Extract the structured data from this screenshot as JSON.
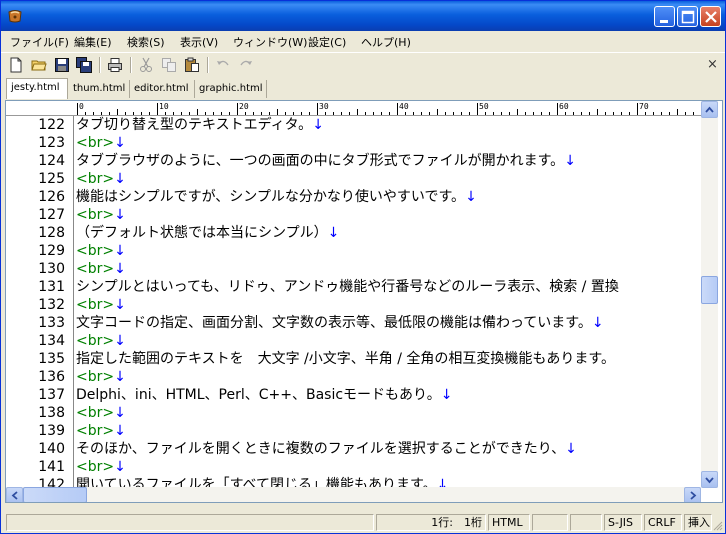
{
  "window": {
    "title": ""
  },
  "menu": [
    "ファイル(F)",
    "編集(E)",
    "検索(S)",
    "表示(V)",
    "ウィンドウ(W)",
    "設定(C)",
    "ヘルプ(H)"
  ],
  "toolbar": {
    "icons": [
      "new-file-icon",
      "open-folder-icon",
      "save-icon",
      "save-all-icon",
      "print-icon",
      "cut-icon",
      "copy-icon",
      "paste-icon",
      "undo-icon",
      "redo-icon"
    ],
    "close_label": "×"
  },
  "tabs": [
    {
      "label": "jesty.html",
      "active": true
    },
    {
      "label": "thum.html",
      "active": false
    },
    {
      "label": "editor.html",
      "active": false
    },
    {
      "label": "graphic.html",
      "active": false
    }
  ],
  "ruler": [
    "0",
    "10",
    "20",
    "30",
    "40",
    "50",
    "60",
    "70"
  ],
  "editor": {
    "eol_mark": "↓",
    "lines": [
      {
        "num": "122",
        "text": "タブ切り替え型のテキストエディタ。",
        "br": false
      },
      {
        "num": "123",
        "text": "<br>",
        "br": true
      },
      {
        "num": "124",
        "text": "タブブラウザのように、一つの画面の中にタブ形式でファイルが開かれます。",
        "br": false
      },
      {
        "num": "125",
        "text": "<br>",
        "br": true
      },
      {
        "num": "126",
        "text": "機能はシンプルですが、シンプルな分かなり使いやすいです。",
        "br": false
      },
      {
        "num": "127",
        "text": "<br>",
        "br": true
      },
      {
        "num": "128",
        "text": "（デフォルト状態では本当にシンプル）",
        "br": false
      },
      {
        "num": "129",
        "text": "<br>",
        "br": true
      },
      {
        "num": "130",
        "text": "<br>",
        "br": true
      },
      {
        "num": "131",
        "text": "シンプルとはいっても、リドゥ、アンドゥ機能や行番号などのルーラ表示、検索 / 置換",
        "br": false,
        "no_eol": true
      },
      {
        "num": "132",
        "text": "<br>",
        "br": true
      },
      {
        "num": "133",
        "text": "文字コードの指定、画面分割、文字数の表示等、最低限の機能は備わっています。",
        "br": false
      },
      {
        "num": "134",
        "text": "<br>",
        "br": true
      },
      {
        "num": "135",
        "text": "指定した範囲のテキストを　大文字 /小文字、半角 / 全角の相互変換機能もあります。",
        "br": false,
        "no_eol": true
      },
      {
        "num": "136",
        "text": "<br>",
        "br": true
      },
      {
        "num": "137",
        "text": "Delphi、ini、HTML、Perl、C++、Basicモードもあり。",
        "br": false
      },
      {
        "num": "138",
        "text": "<br>",
        "br": true
      },
      {
        "num": "139",
        "text": "<br>",
        "br": true
      },
      {
        "num": "140",
        "text": "そのほか、ファイルを開くときに複数のファイルを選択することができたり、",
        "br": false
      },
      {
        "num": "141",
        "text": "<br>",
        "br": true
      },
      {
        "num": "142",
        "text": "開いているファイルを「すべて閉じる」機能もあります。",
        "br": false
      }
    ]
  },
  "status": {
    "position": "1行:　1桁",
    "mode": "HTML",
    "encoding": "S-JIS",
    "newline": "CRLF",
    "insert": "挿入"
  }
}
